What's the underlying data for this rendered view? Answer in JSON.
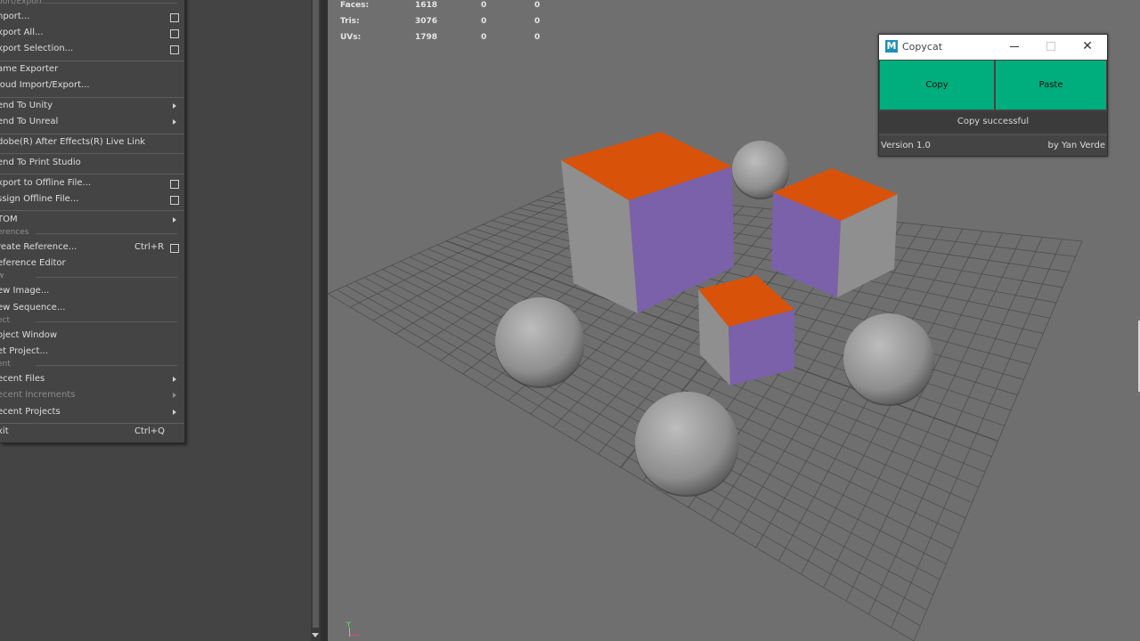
{
  "file_menu": {
    "items": [
      {
        "type": "section",
        "label": "port/Export"
      },
      {
        "type": "item",
        "label": "nport...",
        "option_box": true
      },
      {
        "type": "item",
        "label": "xport All...",
        "option_box": true
      },
      {
        "type": "item",
        "label": "xport Selection...",
        "option_box": true
      },
      {
        "type": "sep"
      },
      {
        "type": "item",
        "label": "ame Exporter"
      },
      {
        "type": "item",
        "label": "loud Import/Export..."
      },
      {
        "type": "sep"
      },
      {
        "type": "item",
        "label": "end To Unity",
        "submenu": true
      },
      {
        "type": "item",
        "label": "end To Unreal",
        "submenu": true
      },
      {
        "type": "sep"
      },
      {
        "type": "item",
        "label": "dobe(R) After Effects(R) Live Link"
      },
      {
        "type": "sep"
      },
      {
        "type": "item",
        "label": "end To Print Studio"
      },
      {
        "type": "sep"
      },
      {
        "type": "item",
        "label": "xport to Offline File...",
        "option_box": true
      },
      {
        "type": "item",
        "label": "ssign Offline File...",
        "option_box": true
      },
      {
        "type": "sep"
      },
      {
        "type": "item",
        "label": "TOM",
        "submenu": true
      },
      {
        "type": "section",
        "label": "erences"
      },
      {
        "type": "item",
        "label": "reate Reference...",
        "shortcut": "Ctrl+R",
        "option_box": true
      },
      {
        "type": "item",
        "label": "eference Editor"
      },
      {
        "type": "section",
        "label": "w"
      },
      {
        "type": "item",
        "label": "ew Image..."
      },
      {
        "type": "item",
        "label": "ew Sequence..."
      },
      {
        "type": "section",
        "label": "ect"
      },
      {
        "type": "item",
        "label": "oject Window"
      },
      {
        "type": "item",
        "label": "et Project..."
      },
      {
        "type": "section",
        "label": "ent"
      },
      {
        "type": "item",
        "label": "ecent Files",
        "submenu": true
      },
      {
        "type": "item",
        "label": "ecent Increments",
        "submenu": true,
        "disabled": true
      },
      {
        "type": "item",
        "label": "ecent Projects",
        "submenu": true
      },
      {
        "type": "sep"
      },
      {
        "type": "item",
        "label": "xit",
        "shortcut": "Ctrl+Q"
      }
    ]
  },
  "hud": {
    "rows": [
      {
        "label": "Faces:",
        "v1": "1618",
        "v2": "0",
        "v3": "0"
      },
      {
        "label": "Tris:",
        "v1": "3076",
        "v2": "0",
        "v3": "0"
      },
      {
        "label": "UVs:",
        "v1": "1798",
        "v2": "0",
        "v3": "0"
      }
    ],
    "axis_label": "Y"
  },
  "scene": {
    "colors": {
      "orange": "#d9520a",
      "purple": "#7a61a9",
      "grey": "#8f8f8f",
      "sphere": "#9c9c9c",
      "grid": "#4e4e4e",
      "background": "#6f6f6f"
    }
  },
  "copycat": {
    "title": "Copycat",
    "app_icon": "M",
    "copy_label": "Copy",
    "paste_label": "Paste",
    "status": "Copy successful",
    "version": "Version 1.0",
    "author": "by Yan Verde",
    "accent": "#00ad7c"
  }
}
